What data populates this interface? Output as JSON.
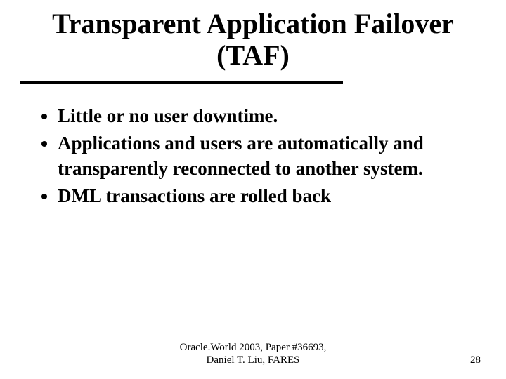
{
  "title": "Transparent Application Failover (TAF)",
  "bullets": {
    "b0": "Little or no user downtime.",
    "b1": "Applications and users are automatically and transparently reconnected to another system.",
    "b2": "DML transactions are rolled back"
  },
  "footer": {
    "line1": "Oracle.World 2003, Paper #36693,",
    "line2": "Daniel T. Liu, FARES",
    "page": "28"
  }
}
